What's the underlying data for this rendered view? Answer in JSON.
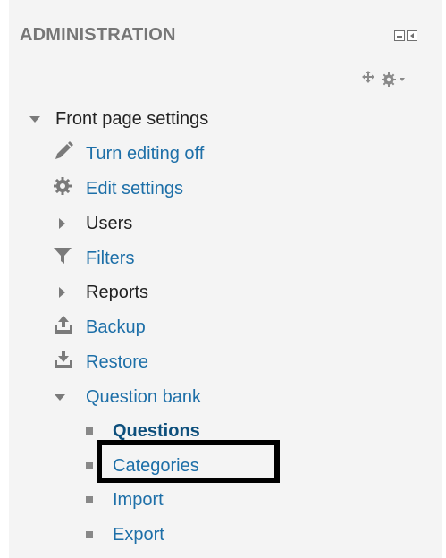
{
  "block": {
    "title": "ADMINISTRATION"
  },
  "colors": {
    "link": "#1d6fa8",
    "panel_bg": "#f4f4f4",
    "icon_grey": "#7a7a7a",
    "highlight_border": "#000000"
  },
  "tree": {
    "front_page_settings": "Front page settings",
    "turn_editing_off": "Turn editing off",
    "edit_settings": "Edit settings",
    "users": "Users",
    "filters": "Filters",
    "reports": "Reports",
    "backup": "Backup",
    "restore": "Restore",
    "question_bank": "Question bank",
    "questions": "Questions",
    "categories": "Categories",
    "import": "Import",
    "export": "Export"
  },
  "icons": {
    "dock": "minimize-icon",
    "collapse": "collapse-left-icon",
    "move": "move-icon",
    "gear": "gear-menu-icon",
    "pencil": "pencil-icon",
    "cog": "cog-icon",
    "filter": "filter-icon",
    "backup": "upload-icon",
    "restore": "download-icon"
  }
}
